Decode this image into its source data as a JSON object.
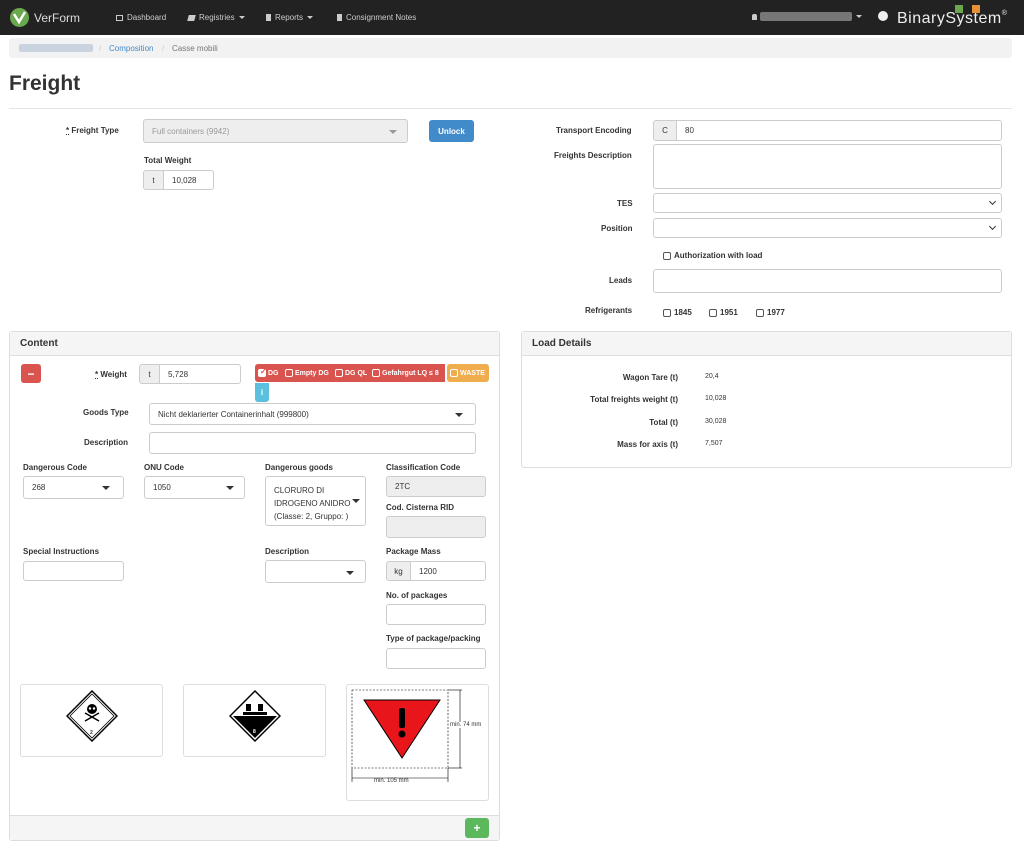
{
  "nav": {
    "brand": "VerForm",
    "items": [
      {
        "label": "Dashboard",
        "icon": "dashboard-icon"
      },
      {
        "label": "Registries",
        "icon": "book-icon"
      },
      {
        "label": "Reports",
        "icon": "file-icon"
      },
      {
        "label": "Consignment Notes",
        "icon": "file-icon"
      }
    ],
    "company_logo": "BinarySystem",
    "company_logo_mark": "®"
  },
  "breadcrumb": {
    "items": [
      "Composition",
      "Casse mobili"
    ],
    "sep": "/"
  },
  "page_title": "Freight",
  "freight": {
    "freight_type_label": "Freight Type",
    "freight_type_value": "Full containers (9942)",
    "unlock_label": "Unlock",
    "total_weight_label": "Total Weight",
    "total_weight_unit": "t",
    "total_weight_value": "10,028",
    "transport_encoding_label": "Transport Encoding",
    "transport_encoding_prefix": "C",
    "transport_encoding_value": "80",
    "freights_description_label": "Freights Description",
    "tes_label": "TES",
    "position_label": "Position",
    "authorization_label": "Authorization with load",
    "leads_label": "Leads",
    "refrigerants_label": "Refrigerants",
    "refrigerants": [
      "1845",
      "1951",
      "1977"
    ]
  },
  "content": {
    "title": "Content",
    "weight_label": "Weight",
    "weight_unit": "t",
    "weight_value": "5,728",
    "badges": [
      {
        "label": "DG",
        "checked": true,
        "color": "#d9534f"
      },
      {
        "label": "Empty DG",
        "checked": false,
        "color": "#d9534f"
      },
      {
        "label": "DG QL",
        "checked": false,
        "color": "#d9534f"
      },
      {
        "label": "Gefahrgut LQ ≤ 8",
        "checked": false,
        "color": "#d9534f"
      },
      {
        "label": "WASTE",
        "checked": false,
        "color": "#f0ad4e"
      }
    ],
    "info_label": "i",
    "goods_type_label": "Goods Type",
    "goods_type_value": "Nicht deklarierter Containerinhalt (999800)",
    "description_label": "Description",
    "dangerous_code_label": "Dangerous Code",
    "dangerous_code_value": "268",
    "onu_code_label": "ONU Code",
    "onu_code_value": "1050",
    "dangerous_goods_label": "Dangerous goods",
    "dangerous_goods_line1": "CLORURO DI",
    "dangerous_goods_line2": "IDROGENO ANIDRO",
    "dangerous_goods_line3": "(Classe: 2, Gruppo: )",
    "classification_code_label": "Classification Code",
    "classification_code_value": "2TC",
    "cod_cisterna_label": "Cod. Cisterna RID",
    "special_instructions_label": "Special Instructions",
    "description2_label": "Description",
    "package_mass_label": "Package Mass",
    "package_mass_unit": "kg",
    "package_mass_value": "1200",
    "num_packages_label": "No. of packages",
    "type_packing_label": "Type of package/packing",
    "hazard_label_1": "2",
    "hazard_label_2": "8",
    "triangle_h": "min. 74 mm",
    "triangle_w": "min. 105 mm",
    "add_label": "+",
    "remove_label": "−"
  },
  "load_details": {
    "title": "Load Details",
    "rows": [
      {
        "label": "Wagon Tare (t)",
        "value": "20,4"
      },
      {
        "label": "Total freights weight (t)",
        "value": "10,028"
      },
      {
        "label": "Total (t)",
        "value": "30,028"
      },
      {
        "label": "Mass for axis (t)",
        "value": "7,507"
      }
    ]
  },
  "colors": {
    "primary": "#428bca",
    "danger": "#d9534f",
    "warning": "#f0ad4e",
    "success": "#5cb85c",
    "info": "#5bc0de",
    "navbar": "#222222"
  }
}
